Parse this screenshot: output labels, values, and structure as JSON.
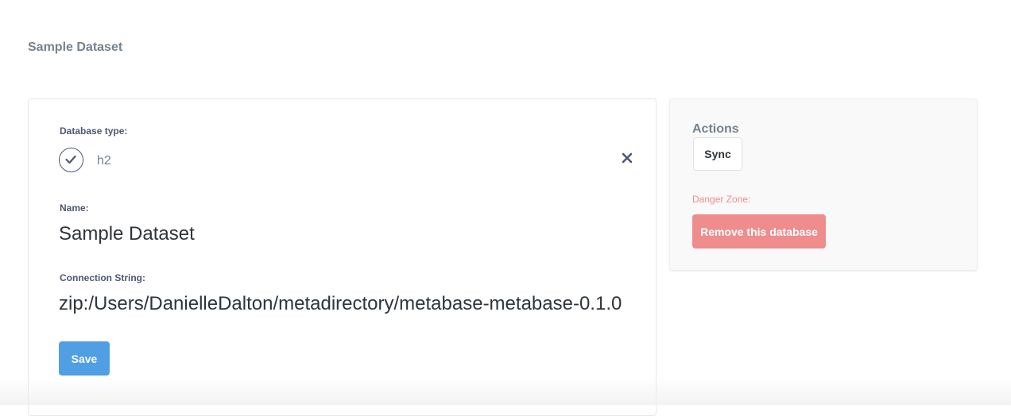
{
  "header": {
    "breadcrumb": "Sample Dataset"
  },
  "form": {
    "db_type_label": "Database type:",
    "db_type_value": "h2",
    "name_label": "Name:",
    "name_value": "Sample Dataset",
    "conn_label": "Connection String:",
    "conn_value": "zip:/Users/DanielleDalton/metadirectory/metabase-metabase-0.1.0",
    "save_label": "Save",
    "icons": {
      "check": "check-icon",
      "close": "close-icon"
    }
  },
  "sidebar": {
    "actions_title": "Actions",
    "sync_label": "Sync",
    "danger_label": "Danger Zone:",
    "remove_label": "Remove this database"
  },
  "colors": {
    "primary": "#509ee3",
    "danger": "#ef8c8c",
    "text_muted": "#74838f"
  }
}
